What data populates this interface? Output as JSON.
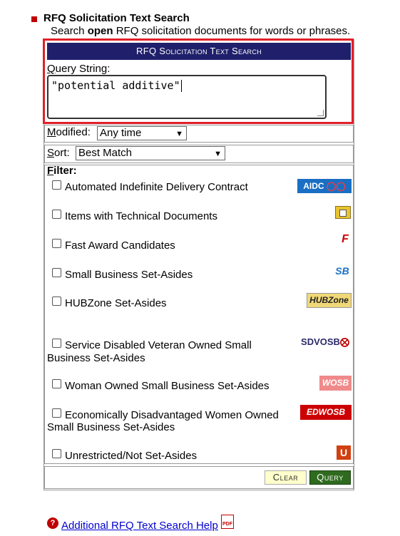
{
  "header": {
    "title": "RFQ Solicitation Text Search",
    "subtitle_pre": "Search ",
    "subtitle_bold": "open",
    "subtitle_post": " RFQ solicitation documents for words or phrases."
  },
  "panel": {
    "heading": "RFQ Solicitation Text Search",
    "query_label": "Query String:",
    "query_value": "\"potential additive\"",
    "modified_label": "Modified:",
    "modified_value": "Any time",
    "sort_label": "Sort:",
    "sort_value": "Best Match",
    "filter_label": "Filter:"
  },
  "filters": [
    {
      "label": "Automated Indefinite Delivery Contract",
      "icon": "aidc-icon",
      "logo_text": "AIDC"
    },
    {
      "label": "Items with Technical Documents",
      "icon": "technical-document-icon",
      "logo_text": ""
    },
    {
      "label": "Fast Award Candidates",
      "icon": "fast-award-icon",
      "logo_text": "F"
    },
    {
      "label": "Small Business Set-Asides",
      "icon": "sb-icon",
      "logo_text": "SB"
    },
    {
      "label": "HUBZone Set-Asides",
      "icon": "hubzone-icon",
      "logo_text": "HUBZone"
    },
    {
      "label": "Service Disabled Veteran Owned Small",
      "label2": "Business Set-Asides",
      "icon": "sdvosb-icon",
      "logo_text": "SDVOSB"
    },
    {
      "label": "Woman Owned Small Business Set-Asides",
      "icon": "wosb-icon",
      "logo_text": "WOSB"
    },
    {
      "label": "Economically Disadvantaged Women Owned",
      "label2": "Small Business Set-Asides",
      "icon": "edwosb-icon",
      "logo_text": "EDWOSB"
    },
    {
      "label": "Unrestricted/Not Set-Asides",
      "icon": "unrestricted-icon",
      "logo_text": "U"
    }
  ],
  "buttons": {
    "clear": "Clear",
    "query": "Query"
  },
  "footer": {
    "help_link": "Additional RFQ Text Search Help",
    "pdf_text": "PDF"
  },
  "colors": {
    "accent_red": "#e0202a",
    "header_navy": "#1f1f6b",
    "query_green": "#2f6b1f",
    "clear_bg": "#ffffcc",
    "link_blue": "#0000cc"
  }
}
